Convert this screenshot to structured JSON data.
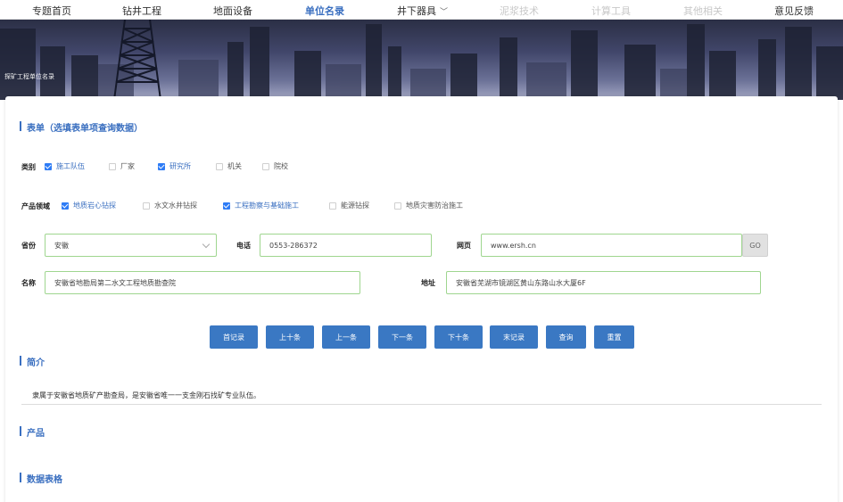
{
  "nav": [
    {
      "label": "专题首页",
      "state": "normal"
    },
    {
      "label": "钻井工程",
      "state": "normal"
    },
    {
      "label": "地面设备",
      "state": "normal"
    },
    {
      "label": "单位名录",
      "state": "active"
    },
    {
      "label": "井下器具",
      "state": "normal"
    },
    {
      "label": "泥浆技术",
      "state": "disabled"
    },
    {
      "label": "计算工具",
      "state": "disabled"
    },
    {
      "label": "其他相关",
      "state": "disabled"
    },
    {
      "label": "意见反馈",
      "state": "normal"
    }
  ],
  "banner": {
    "title": "探矿工程单位名录"
  },
  "form": {
    "title": "表单（选填表单项查询数据）",
    "category": {
      "label": "类别",
      "options": [
        {
          "label": "施工队伍",
          "checked": true
        },
        {
          "label": "厂家",
          "checked": false
        },
        {
          "label": "研究所",
          "checked": true
        },
        {
          "label": "机关",
          "checked": false
        },
        {
          "label": "院校",
          "checked": false
        }
      ]
    },
    "domain": {
      "label": "产品领域",
      "options": [
        {
          "label": "地质岩心钻探",
          "checked": true
        },
        {
          "label": "水文水井钻探",
          "checked": false
        },
        {
          "label": "工程勘察与基础施工",
          "checked": true
        },
        {
          "label": "能源钻探",
          "checked": false
        },
        {
          "label": "地质灾害防治施工",
          "checked": false
        }
      ]
    },
    "province": {
      "label": "省份",
      "value": "安徽"
    },
    "phone": {
      "label": "电话",
      "value": "0553-286372"
    },
    "website": {
      "label": "网页",
      "value": "www.ersh.cn",
      "go": "GO"
    },
    "name": {
      "label": "名称",
      "value": "安徽省地勘局第二水文工程地质勘查院"
    },
    "address": {
      "label": "地址",
      "value": "安徽省芜湖市镜湖区黄山东路山水大厦6F"
    }
  },
  "buttons": [
    "首记录",
    "上十条",
    "上一条",
    "下一条",
    "下十条",
    "末记录",
    "查询",
    "重置"
  ],
  "intro": {
    "title": "简介",
    "text": "隶属于安徽省地质矿产勘查局，是安徽省唯一一支金刚石找矿专业队伍。"
  },
  "product": {
    "title": "产品"
  },
  "datatable": {
    "title": "数据表格"
  },
  "colors": {
    "accent": "#3a6fc0",
    "button": "#3a78c3",
    "field_border": "#9fd68f",
    "checkbox": "#2e7cf6"
  }
}
